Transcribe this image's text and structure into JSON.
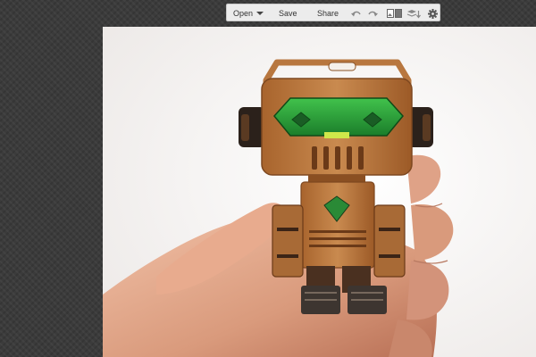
{
  "toolbar": {
    "open_label": "Open",
    "save_label": "Save",
    "share_label": "Share",
    "icons": [
      "chevron-down-icon",
      "undo-icon",
      "redo-icon",
      "compare-icon",
      "layers-icon",
      "gear-icon"
    ]
  },
  "image": {
    "subject": "wooden-robot-figure-in-hand"
  },
  "colors": {
    "toolbar_bg": "#ececec",
    "workspace_bg": "#3b3b3b",
    "canvas_bg": "#fbfbfb",
    "wood": "#b8773f",
    "visor_green": "#2ea33c"
  }
}
